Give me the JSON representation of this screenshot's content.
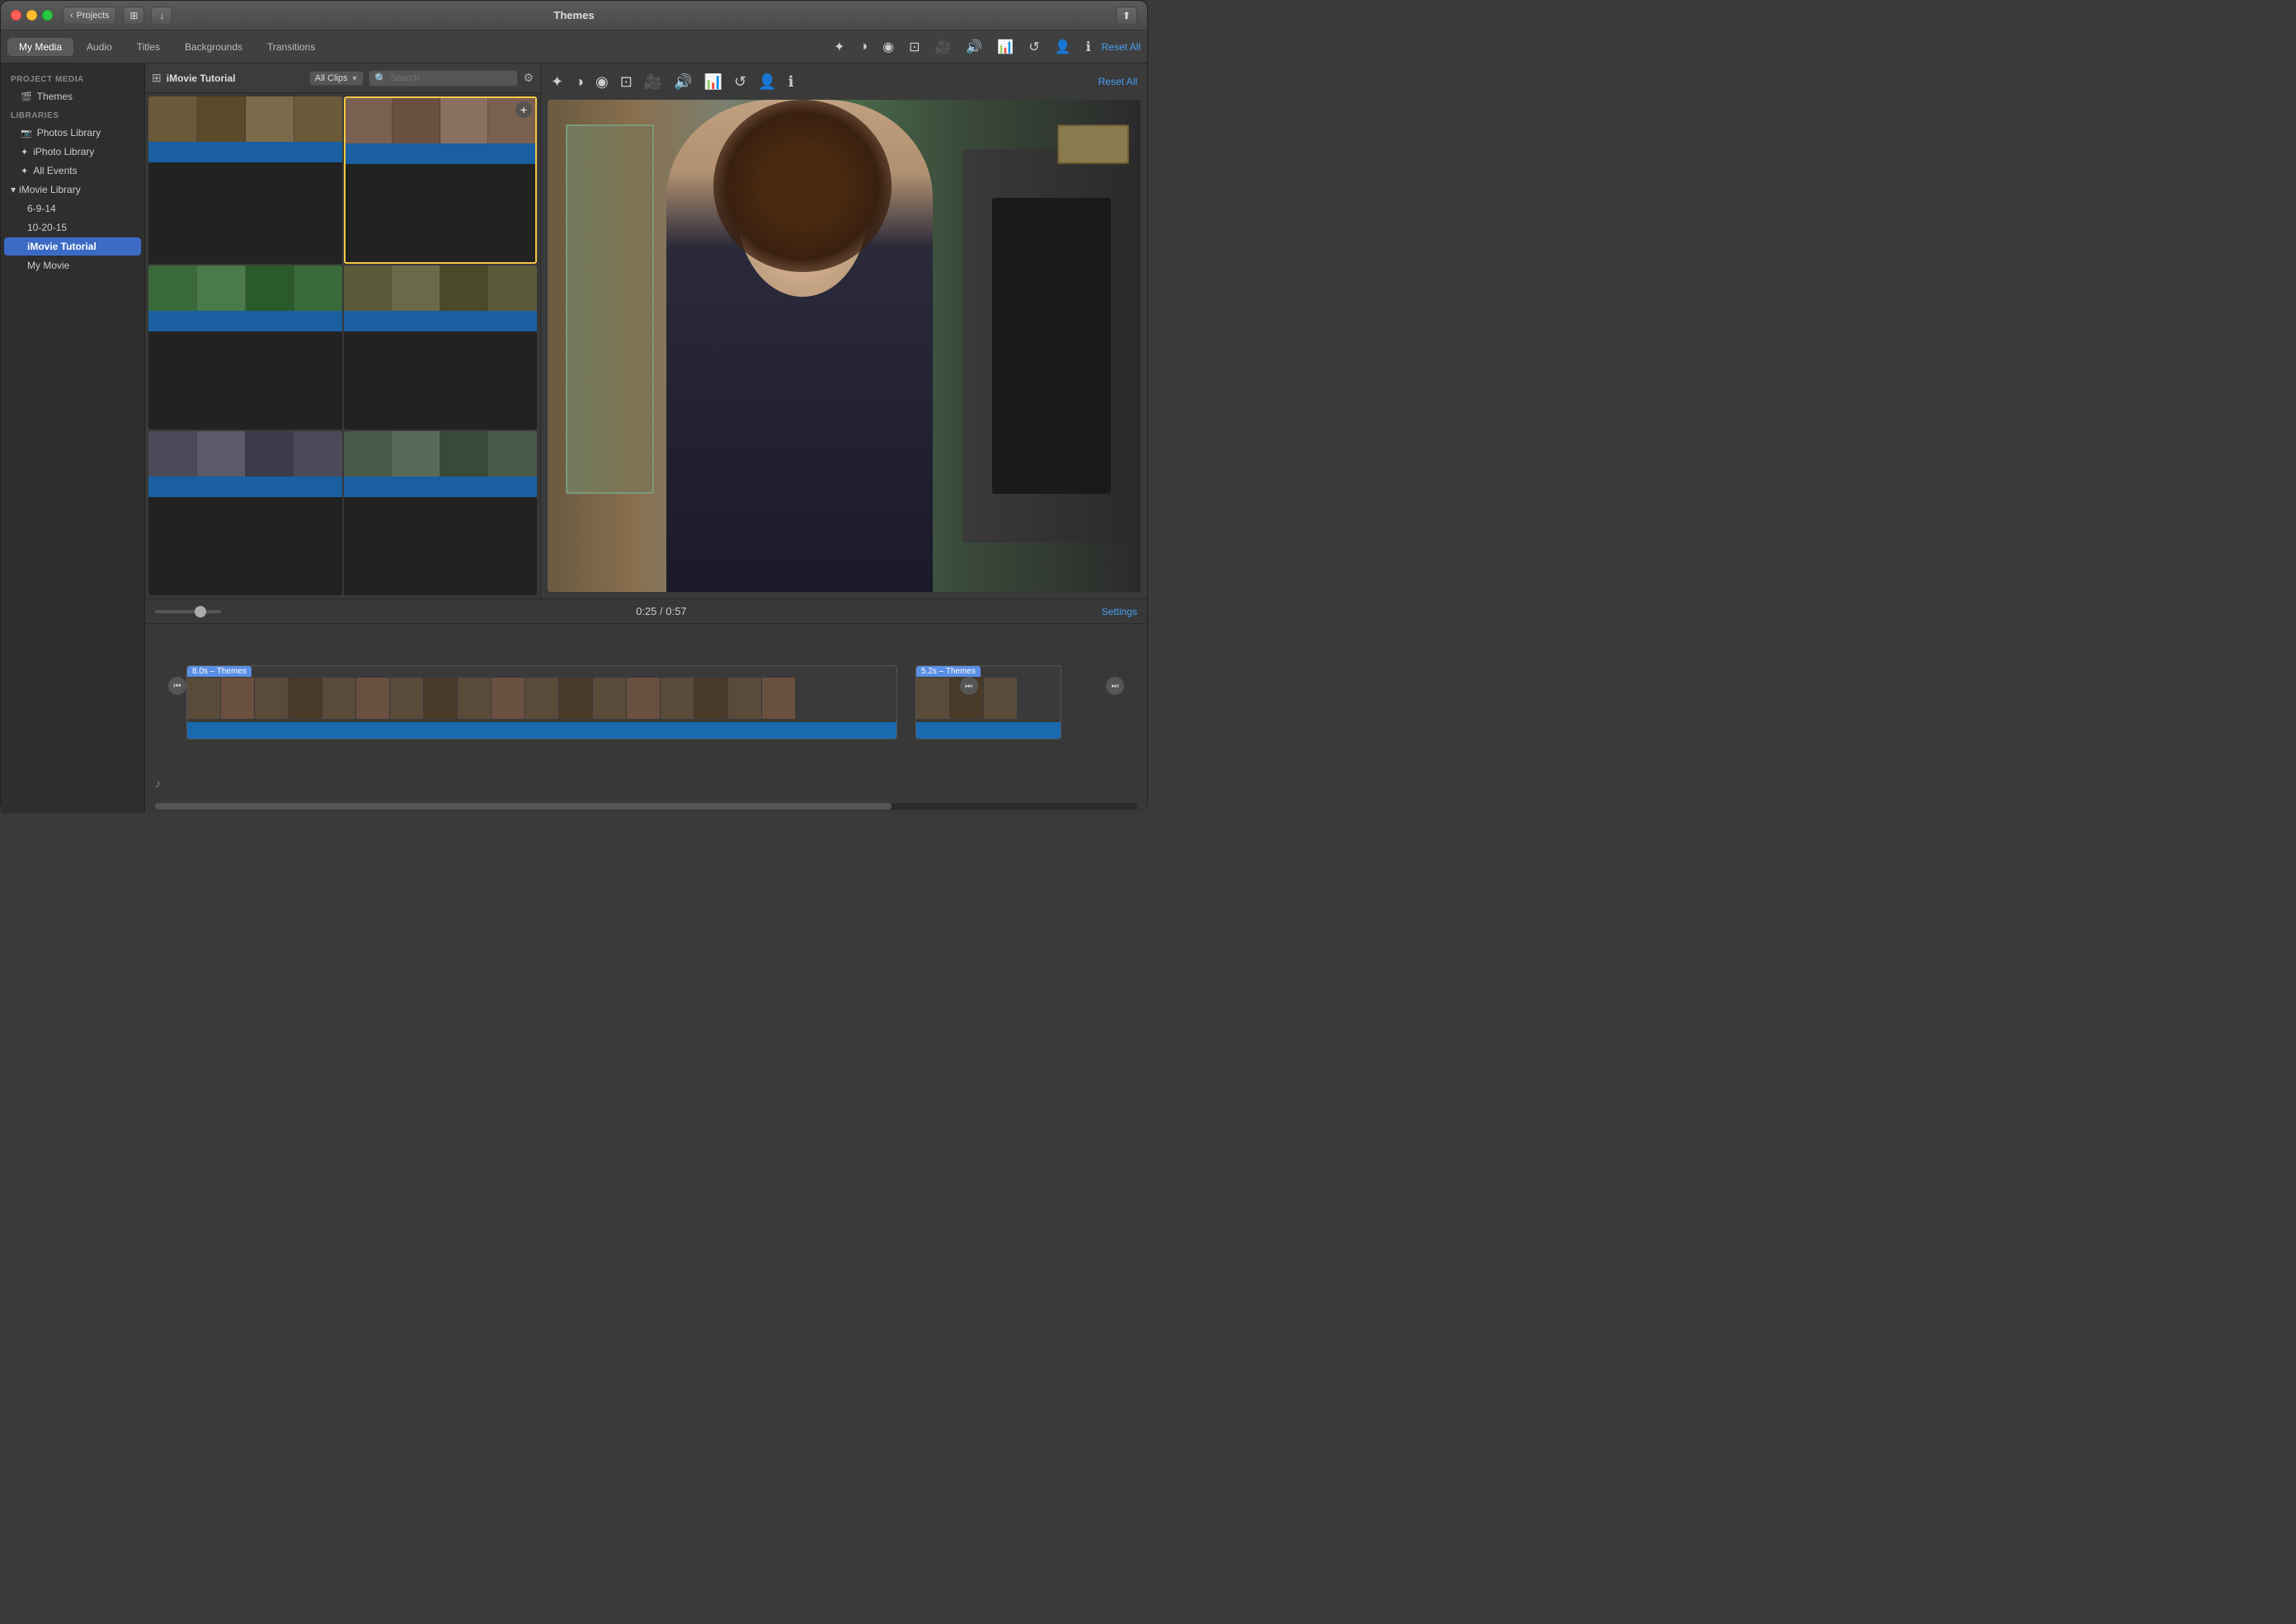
{
  "titlebar": {
    "title": "Themes",
    "back_btn": "Projects",
    "share_icon": "⬆"
  },
  "toolbar": {
    "tabs": [
      {
        "id": "my-media",
        "label": "My Media",
        "active": true
      },
      {
        "id": "audio",
        "label": "Audio"
      },
      {
        "id": "titles",
        "label": "Titles"
      },
      {
        "id": "backgrounds",
        "label": "Backgrounds"
      },
      {
        "id": "transitions",
        "label": "Transitions"
      }
    ],
    "reset_all": "Reset All"
  },
  "sidebar": {
    "project_section": "PROJECT MEDIA",
    "themes_item": "Themes",
    "libraries_section": "LIBRARIES",
    "items": [
      {
        "id": "photos",
        "label": "Photos Library",
        "icon": "📷"
      },
      {
        "id": "iphoto",
        "label": "iPhoto Library",
        "icon": "✦"
      },
      {
        "id": "events",
        "label": "All Events",
        "icon": "✦"
      },
      {
        "id": "imovie-lib",
        "label": "iMovie Library",
        "icon": "▼",
        "disclosure": true
      },
      {
        "id": "6-9-14",
        "label": "6-9-14",
        "indent": true
      },
      {
        "id": "10-20-15",
        "label": "10-20-15",
        "indent": true
      },
      {
        "id": "imovie-tutorial",
        "label": "iMovie Tutorial",
        "indent": true,
        "active": true
      },
      {
        "id": "my-movie",
        "label": "My Movie",
        "indent": true
      }
    ]
  },
  "browser": {
    "title": "iMovie Tutorial",
    "filter": "All Clips",
    "search_placeholder": "Search",
    "clips": [
      {
        "id": 1,
        "color": "#5a4a3a"
      },
      {
        "id": 2,
        "color": "#3a5a3a",
        "selected": true
      },
      {
        "id": 3,
        "color": "#2a4a2a"
      },
      {
        "id": 4,
        "color": "#5a4a2a"
      },
      {
        "id": 5,
        "color": "#4a4a5a"
      },
      {
        "id": 6,
        "color": "#5a4a3a"
      }
    ]
  },
  "preview": {
    "timecode": "0:25 / 0:57",
    "settings_label": "Settings",
    "icons": [
      "✦",
      "◑",
      "◉",
      "⊞",
      "🎥",
      "🔊",
      "📊",
      "↺",
      "👤",
      "ℹ"
    ]
  },
  "timeline": {
    "clip1_label": "8.0s – Themes",
    "clip2_label": "5.2s – Themes",
    "settings": "Settings",
    "music_note": "♪"
  }
}
